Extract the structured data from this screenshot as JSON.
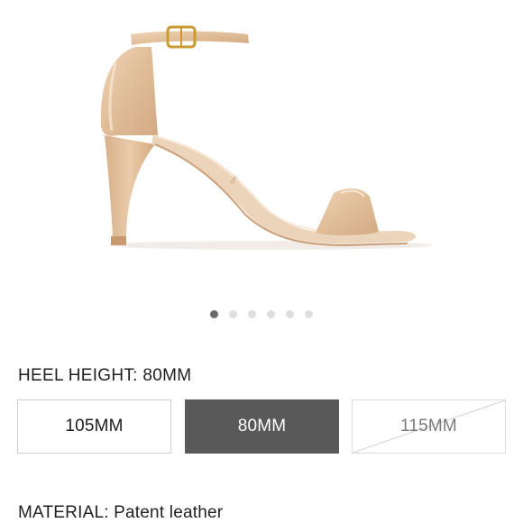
{
  "product": {
    "image": {
      "alt": "Nude patent leather ankle-strap sandal",
      "accent": "#e2c1a0"
    },
    "carousel": {
      "count": 6,
      "active": 0
    }
  },
  "heel": {
    "label": "HEEL HEIGHT: 80MM",
    "options": [
      {
        "label": "105MM",
        "state": "available"
      },
      {
        "label": "80MM",
        "state": "selected"
      },
      {
        "label": "115MM",
        "state": "unavailable"
      }
    ]
  },
  "material": {
    "label": "MATERIAL: Patent leather"
  },
  "colors": {
    "selected": "#595959",
    "border": "#cfcfcf",
    "dot_active": "#6b6b6b",
    "dot_inactive": "#dedede"
  }
}
